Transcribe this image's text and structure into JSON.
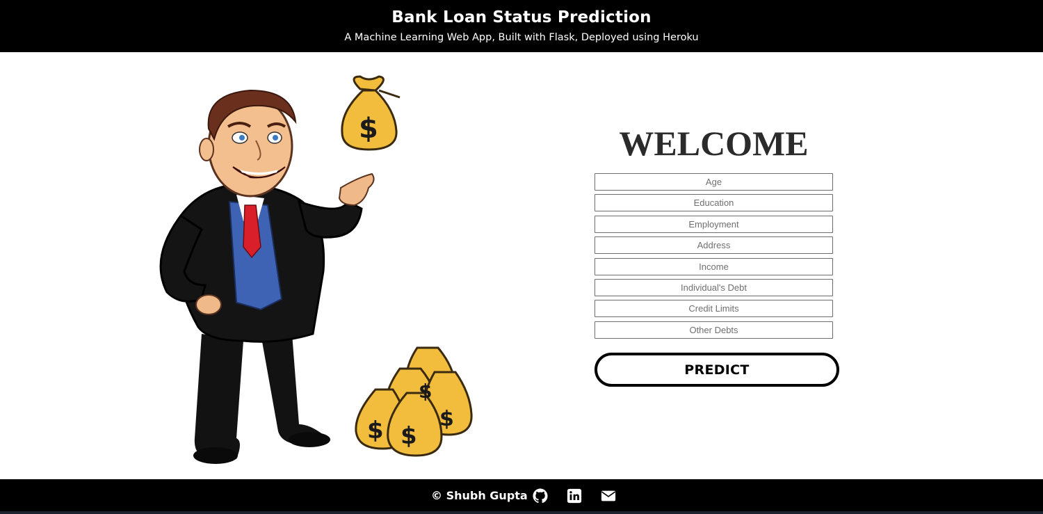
{
  "header": {
    "title": "Bank Loan Status Prediction",
    "subtitle": "A Machine Learning Web App, Built with Flask, Deployed using Heroku"
  },
  "main": {
    "welcome": "WELCOME",
    "fields": {
      "age": {
        "placeholder": "Age"
      },
      "education": {
        "placeholder": "Education"
      },
      "employment": {
        "placeholder": "Employment"
      },
      "address": {
        "placeholder": "Address"
      },
      "income": {
        "placeholder": "Income"
      },
      "individuals_debt": {
        "placeholder": "Individual's Debt"
      },
      "credit_limits": {
        "placeholder": "Credit Limits"
      },
      "other_debts": {
        "placeholder": "Other Debts"
      }
    },
    "predict_label": "PREDICT"
  },
  "footer": {
    "copyright": "© Shubh Gupta",
    "icons": [
      "github-icon",
      "linkedin-icon",
      "envelope-icon"
    ]
  },
  "colors": {
    "header_bg": "#000000",
    "footer_bg": "#000000",
    "money_bag": "#f2bd3c",
    "suit": "#141414",
    "vest": "#3e63b4",
    "tie": "#d81f2a"
  }
}
